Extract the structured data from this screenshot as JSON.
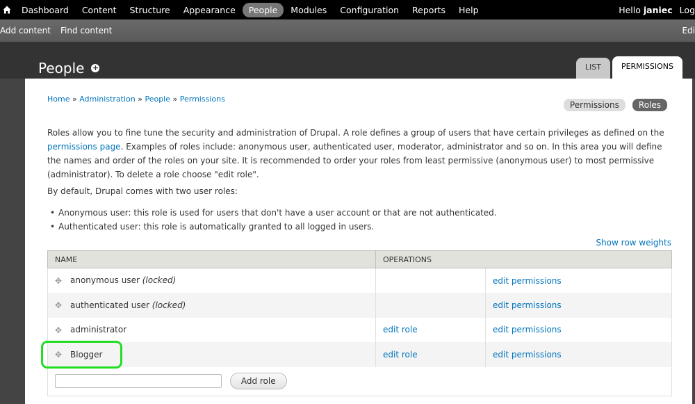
{
  "toolbar": {
    "menu": [
      "Dashboard",
      "Content",
      "Structure",
      "Appearance",
      "People",
      "Modules",
      "Configuration",
      "Reports",
      "Help"
    ],
    "active": "People",
    "hello": "Hello",
    "username": "janiec",
    "logout": "Log"
  },
  "shortcuts": {
    "add_content": "Add content",
    "find_content": "Find content",
    "edit": "Edi"
  },
  "header": {
    "title": "People",
    "tabs": [
      "LIST",
      "PERMISSIONS"
    ]
  },
  "breadcrumb": [
    "Home",
    "Administration",
    "People",
    "Permissions"
  ],
  "secondary_tabs": [
    "Permissions",
    "Roles"
  ],
  "intro": {
    "before_link": "Roles allow you to fine tune the security and administration of Drupal. A role defines a group of users that have certain privileges as defined on the ",
    "link": "permissions page",
    "after_link": ". Examples of roles include: anonymous user, authenticated user, moderator, administrator and so on. In this area you will define the names and order of the roles on your site. It is recommended to order your roles from least permissive (anonymous user) to most permissive (administrator). To delete a role choose \"edit role\"."
  },
  "default_roles_text": "By default, Drupal comes with two user roles:",
  "bullets": [
    "Anonymous user: this role is used for users that don't have a user account or that are not authenticated.",
    "Authenticated user: this role is automatically granted to all logged in users."
  ],
  "show_row_weights": "Show row weights",
  "table": {
    "headers": [
      "NAME",
      "OPERATIONS"
    ],
    "rows": [
      {
        "name": "anonymous user",
        "locked": "(locked)",
        "edit_role": "",
        "edit_permissions": "edit permissions"
      },
      {
        "name": "authenticated user",
        "locked": "(locked)",
        "edit_role": "",
        "edit_permissions": "edit permissions"
      },
      {
        "name": "administrator",
        "locked": "",
        "edit_role": "edit role",
        "edit_permissions": "edit permissions"
      },
      {
        "name": "Blogger",
        "locked": "",
        "edit_role": "edit role",
        "edit_permissions": "edit permissions"
      }
    ],
    "new_role_value": "",
    "add_role_label": "Add role"
  }
}
